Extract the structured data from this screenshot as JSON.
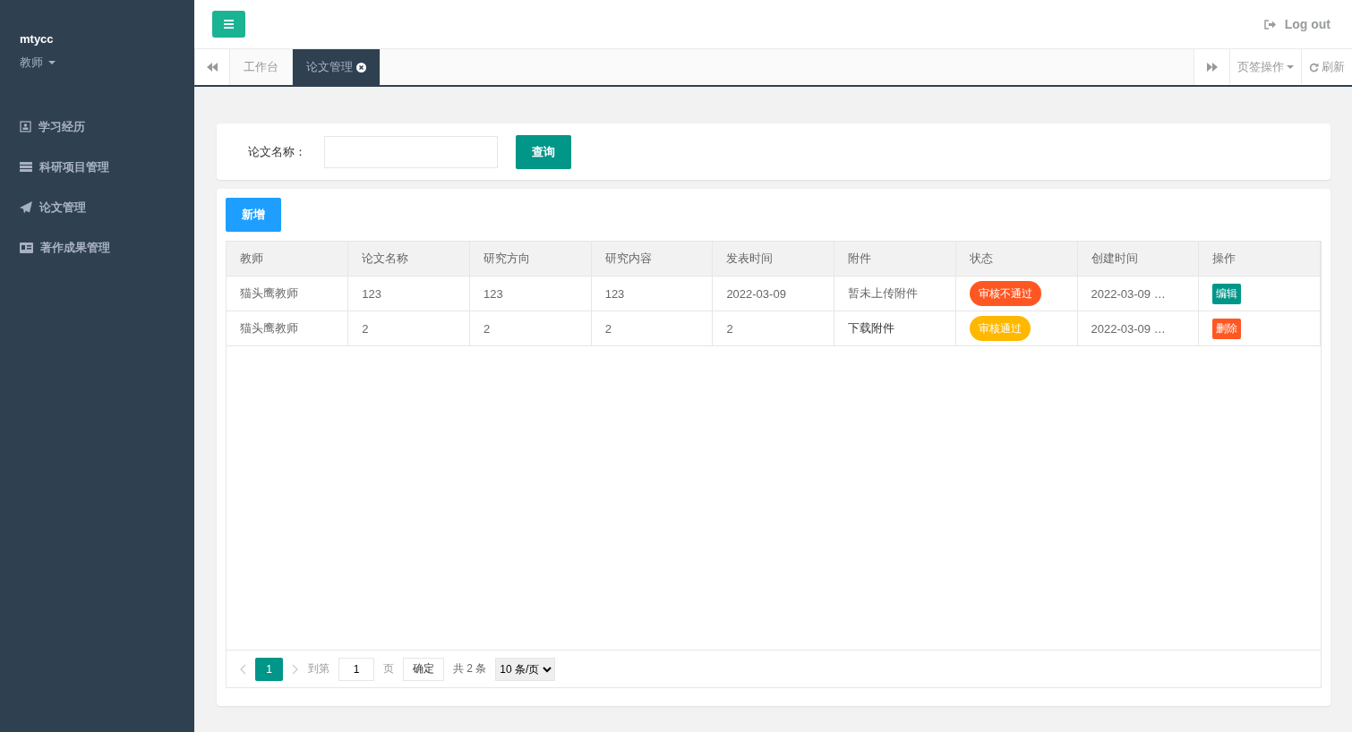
{
  "sidebar": {
    "user": "mtycc",
    "role": "教师",
    "items": [
      {
        "label": "学习经历"
      },
      {
        "label": "科研项目管理"
      },
      {
        "label": "论文管理"
      },
      {
        "label": "著作成果管理"
      }
    ]
  },
  "header": {
    "logout": "Log out"
  },
  "tabs": {
    "items": [
      {
        "label": "工作台",
        "selected": false,
        "closable": false
      },
      {
        "label": "论文管理",
        "selected": true,
        "closable": true
      }
    ],
    "page_ops": "页签操作",
    "refresh": "刷新"
  },
  "search": {
    "label": "论文名称：",
    "button": "查询"
  },
  "toolbar": {
    "add": "新增"
  },
  "table": {
    "columns": [
      "教师",
      "论文名称",
      "研究方向",
      "研究内容",
      "发表时间",
      "附件",
      "状态",
      "创建时间",
      "操作"
    ],
    "rows": [
      {
        "teacher": "猫头鹰教师",
        "title": "123",
        "direction": "123",
        "content": "123",
        "published": "2022-03-09",
        "attachment": "暂未上传附件",
        "attachment_link": false,
        "status": "审核不通过",
        "color": "#ff5722",
        "created": "2022-03-09 …",
        "action": "编辑",
        "kind": "edit"
      },
      {
        "teacher": "猫头鹰教师",
        "title": "2",
        "direction": "2",
        "content": "2",
        "published": "2",
        "attachment": "下载附件",
        "attachment_link": true,
        "status": "审核通过",
        "color": "#ffb800",
        "created": "2022-03-09 …",
        "action": "删除",
        "kind": "delete"
      }
    ]
  },
  "pagination": {
    "pages": [
      {
        "label": "1",
        "selected": true
      }
    ],
    "goto_label": "到第",
    "goto_value": "1",
    "page_unit": "页",
    "confirm": "确定",
    "total": "共 2 条",
    "page_size": "10 条/页"
  }
}
